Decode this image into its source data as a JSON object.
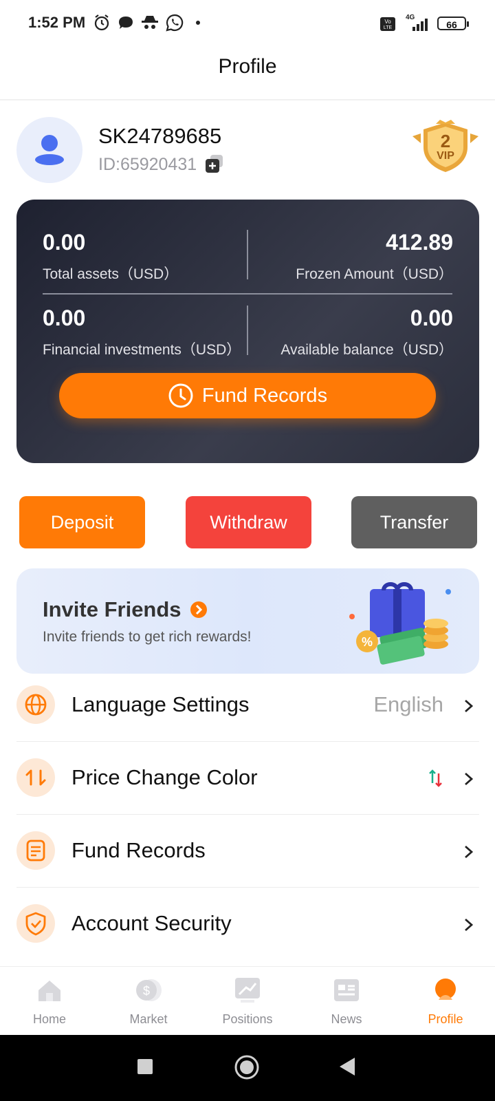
{
  "status_bar": {
    "time": "1:52 PM",
    "icons": [
      "alarm-icon",
      "chat-icon",
      "spy-icon",
      "whatsapp-icon",
      "dot-icon",
      "volte-icon",
      "signal-4g-icon",
      "battery-icon"
    ],
    "network_label": "4G",
    "battery": "66"
  },
  "header": {
    "title": "Profile"
  },
  "profile": {
    "username": "SK24789685",
    "id_text": "ID:65920431",
    "vip_level": "2",
    "vip_label": "VIP"
  },
  "assets": {
    "total_assets": {
      "value": "0.00",
      "label": "Total assets（USD）"
    },
    "frozen_amount": {
      "value": "412.89",
      "label": "Frozen Amount（USD）"
    },
    "financial_investments": {
      "value": "0.00",
      "label": "Financial investments（USD）"
    },
    "available_balance": {
      "value": "0.00",
      "label": "Available balance（USD）"
    },
    "fund_records_button": "Fund Records"
  },
  "actions": {
    "deposit": "Deposit",
    "withdraw": "Withdraw",
    "transfer": "Transfer"
  },
  "invite": {
    "title": "Invite Friends",
    "subtitle": "Invite friends to get rich rewards!"
  },
  "settings": [
    {
      "label": "Language Settings",
      "value": "English",
      "icon": "globe-icon"
    },
    {
      "label": "Price Change Color",
      "value": "",
      "icon": "swap-icon"
    },
    {
      "label": "Fund Records",
      "value": "",
      "icon": "document-icon"
    },
    {
      "label": "Account Security",
      "value": "",
      "icon": "shield-check-icon"
    }
  ],
  "tabs": [
    {
      "label": "Home",
      "active": false
    },
    {
      "label": "Market",
      "active": false
    },
    {
      "label": "Positions",
      "active": false
    },
    {
      "label": "News",
      "active": false
    },
    {
      "label": "Profile",
      "active": true
    }
  ],
  "colors": {
    "accent": "#ff7a06",
    "withdraw": "#f4433c",
    "transfer": "#5f5f5f",
    "tab_inactive": "#8d8d93"
  }
}
